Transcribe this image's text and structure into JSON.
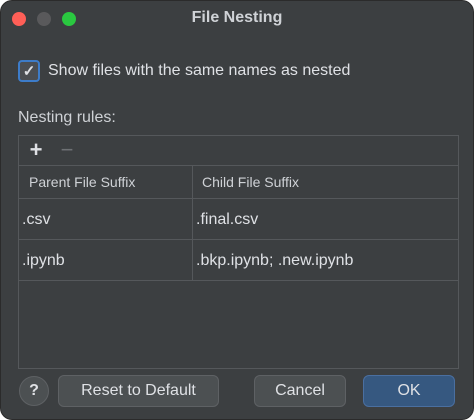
{
  "window": {
    "title": "File Nesting"
  },
  "options": {
    "nest_same_names_label": "Show files with the same names as nested",
    "nest_same_names_checked": true
  },
  "rules": {
    "section_label": "Nesting rules:",
    "add_icon": "plus-icon",
    "remove_icon": "minus-icon",
    "columns": {
      "parent": "Parent File Suffix",
      "child": "Child File Suffix"
    },
    "rows": [
      {
        "parent": ".csv",
        "child": ".final.csv"
      },
      {
        "parent": ".ipynb",
        "child": ".bkp.ipynb; .new.ipynb"
      }
    ]
  },
  "footer": {
    "help_label": "?",
    "reset_label": "Reset to Default",
    "cancel_label": "Cancel",
    "ok_label": "OK"
  },
  "colors": {
    "background": "#3c3f41",
    "accent": "#365880",
    "close": "#ff5f57",
    "maximize": "#2ac840"
  }
}
